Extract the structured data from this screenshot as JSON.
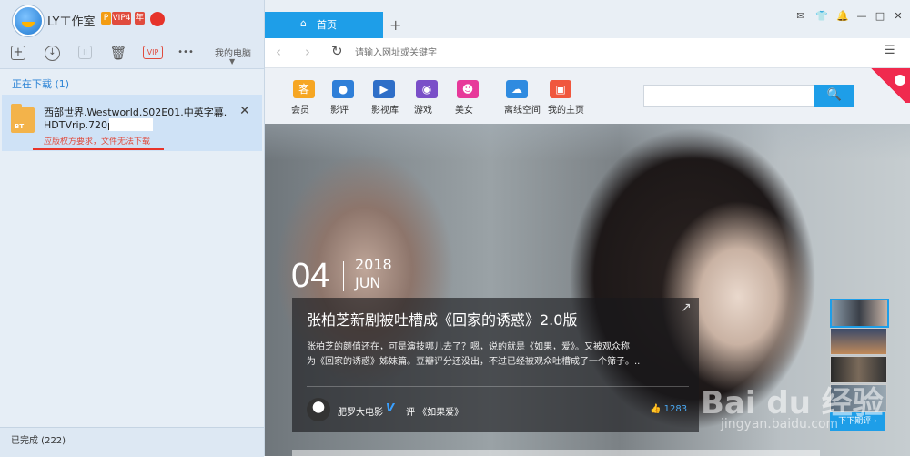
{
  "left_panel": {
    "username": "LY工作室",
    "badges": [
      "P",
      "VIP4",
      "年"
    ],
    "toolbar": {
      "add": "+",
      "download": "↓",
      "pause": "II",
      "delete": "🗑",
      "vip": "VIP",
      "more": "•••"
    },
    "my_pc_label": "我的电脑",
    "downloading_label": "正在下载 (1)",
    "download_item": {
      "name_line1": "西部世界.Westworld.S02E01.中英字幕.",
      "name_line2": "HDTVrip.720p-",
      "type_label": "BT",
      "error": "应版权方要求，文件无法下载"
    },
    "completed_label": "已完成 (222)"
  },
  "browser": {
    "tab_home_label": "首页",
    "tab_home_icon": "⌂",
    "new_tab": "+",
    "url_placeholder": "请输入网址或关键字",
    "nav_back": "‹",
    "nav_forward": "›",
    "refresh": "↻",
    "menu": "☰",
    "window_controls": [
      "✉",
      "👕",
      "🔔",
      "—",
      "□",
      "✕"
    ]
  },
  "site": {
    "nav": [
      {
        "label": "会员",
        "icon_text": "客",
        "color": "#f6a623"
      },
      {
        "label": "影评",
        "icon_text": "●",
        "color": "#2f7fd8"
      },
      {
        "label": "影视库",
        "icon_text": "▶",
        "color": "#2f6fc8"
      },
      {
        "label": "游戏",
        "icon_text": "◉",
        "color": "#7a4fc8"
      },
      {
        "label": "美女",
        "icon_text": "☻",
        "color": "#e7399a"
      },
      {
        "label": "离线空间",
        "icon_text": "☁",
        "color": "#2f8be0"
      },
      {
        "label": "我的主页",
        "icon_text": "▣",
        "color": "#f0573d"
      }
    ],
    "search_button": "🔍",
    "hero": {
      "day": "04",
      "year": "2018",
      "month": "JUN",
      "title": "张柏芝新剧被吐槽成《回家的诱惑》2.0版",
      "desc_line1": "张柏芝的颜值还在，可是演技哪儿去了？嗯，说的就是《如果，爱》。又被观众称",
      "desc_line2": "为《回家的诱惑》姊妹篇。豆瓣评分还没出，不过已经被观众吐槽成了一个筛子。..",
      "author": "肥罗大电影",
      "verified": "V",
      "review": "评 《如果爱》",
      "likes": "1283",
      "more_label": "下下期评 ›"
    },
    "watermark": "Bai du 经验",
    "watermark_url": "jingyan.baidu.com"
  }
}
